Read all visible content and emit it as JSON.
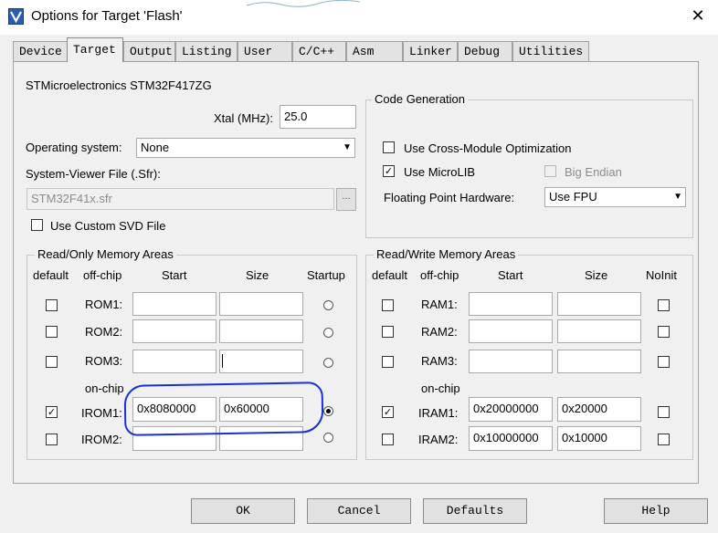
{
  "window": {
    "title": "Options for Target 'Flash'",
    "close_glyph": "✕"
  },
  "tabs": [
    "Device",
    "Target",
    "Output",
    "Listing",
    "User",
    "C/C++",
    "Asm",
    "Linker",
    "Debug",
    "Utilities"
  ],
  "active_tab": "Target",
  "device_name": "STMicroelectronics STM32F417ZG",
  "xtal": {
    "label": "Xtal (MHz):",
    "value": "25.0"
  },
  "os": {
    "label": "Operating system:",
    "value": "None"
  },
  "sysviewer": {
    "label": "System-Viewer File (.Sfr):",
    "value": "STM32F41x.sfr",
    "browse": "..."
  },
  "custom_svd": {
    "label": "Use Custom SVD File",
    "checked": false
  },
  "code_gen": {
    "title": "Code Generation",
    "cross_module": {
      "label": "Use Cross-Module Optimization",
      "checked": false
    },
    "microlib": {
      "label": "Use MicroLIB",
      "checked": true
    },
    "big_endian": {
      "label": "Big Endian",
      "checked": false,
      "disabled": true
    },
    "fpu": {
      "label": "Floating Point Hardware:",
      "value": "Use FPU"
    }
  },
  "ro_memory": {
    "title": "Read/Only Memory Areas",
    "headers": {
      "default": "default",
      "offchip": "off-chip",
      "start": "Start",
      "size": "Size",
      "extra": "Startup"
    },
    "onchip_label": "on-chip",
    "rows": [
      {
        "name": "ROM1:",
        "default": false,
        "start": "",
        "size": "",
        "startup": false
      },
      {
        "name": "ROM2:",
        "default": false,
        "start": "",
        "size": "",
        "startup": false
      },
      {
        "name": "ROM3:",
        "default": false,
        "start": "",
        "size": "",
        "startup": false
      },
      {
        "name": "IROM1:",
        "default": true,
        "start": "0x8080000",
        "size": "0x60000",
        "startup": true
      },
      {
        "name": "IROM2:",
        "default": false,
        "start": "",
        "size": "",
        "startup": false
      }
    ]
  },
  "rw_memory": {
    "title": "Read/Write Memory Areas",
    "headers": {
      "default": "default",
      "offchip": "off-chip",
      "start": "Start",
      "size": "Size",
      "extra": "NoInit"
    },
    "onchip_label": "on-chip",
    "rows": [
      {
        "name": "RAM1:",
        "default": false,
        "start": "",
        "size": "",
        "noinit": false
      },
      {
        "name": "RAM2:",
        "default": false,
        "start": "",
        "size": "",
        "noinit": false
      },
      {
        "name": "RAM3:",
        "default": false,
        "start": "",
        "size": "",
        "noinit": false
      },
      {
        "name": "IRAM1:",
        "default": true,
        "start": "0x20000000",
        "size": "0x20000",
        "noinit": false
      },
      {
        "name": "IRAM2:",
        "default": false,
        "start": "0x10000000",
        "size": "0x10000",
        "noinit": false
      }
    ]
  },
  "buttons": {
    "ok": "OK",
    "cancel": "Cancel",
    "defaults": "Defaults",
    "help": "Help"
  },
  "colors": {
    "annotation": "#1b2fd8",
    "background": "#f0f0f0"
  }
}
